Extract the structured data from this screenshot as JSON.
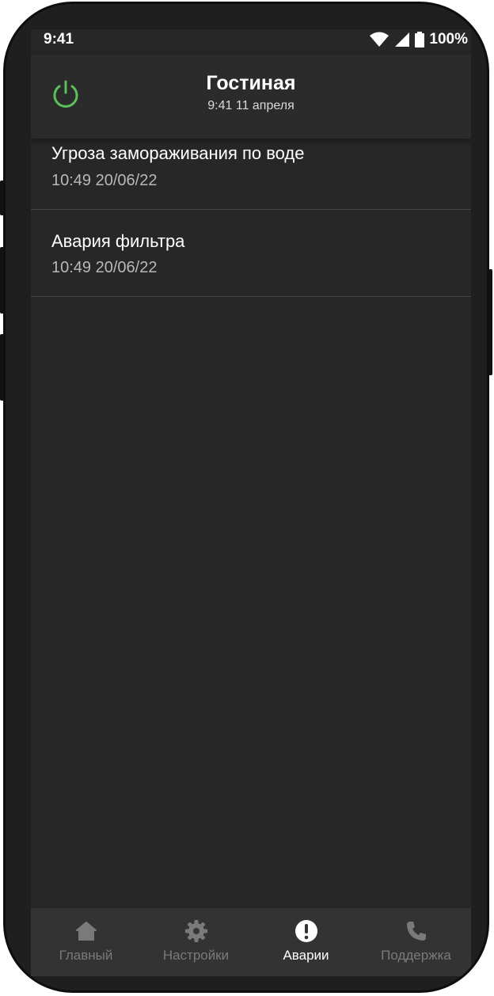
{
  "status_bar": {
    "time": "9:41",
    "battery": "100%"
  },
  "header": {
    "title": "Гостиная",
    "subtitle": "9:41 11 апреля"
  },
  "alarms": [
    {
      "title": "Угроза замораживания по воде",
      "time": "10:49 20/06/22"
    },
    {
      "title": "Авария фильтра",
      "time": "10:49 20/06/22"
    }
  ],
  "nav": {
    "items": [
      {
        "label": "Главный",
        "icon": "home-icon"
      },
      {
        "label": "Настройки",
        "icon": "gear-icon"
      },
      {
        "label": "Аварии",
        "icon": "alert-icon"
      },
      {
        "label": "Поддержка",
        "icon": "phone-icon"
      }
    ],
    "active": "Аварии"
  },
  "colors": {
    "power_accent": "#5bbf5b",
    "screen_bg": "#272727",
    "nav_bg": "#333333",
    "nav_inactive": "#7a7a7a",
    "nav_active": "#ffffff"
  }
}
